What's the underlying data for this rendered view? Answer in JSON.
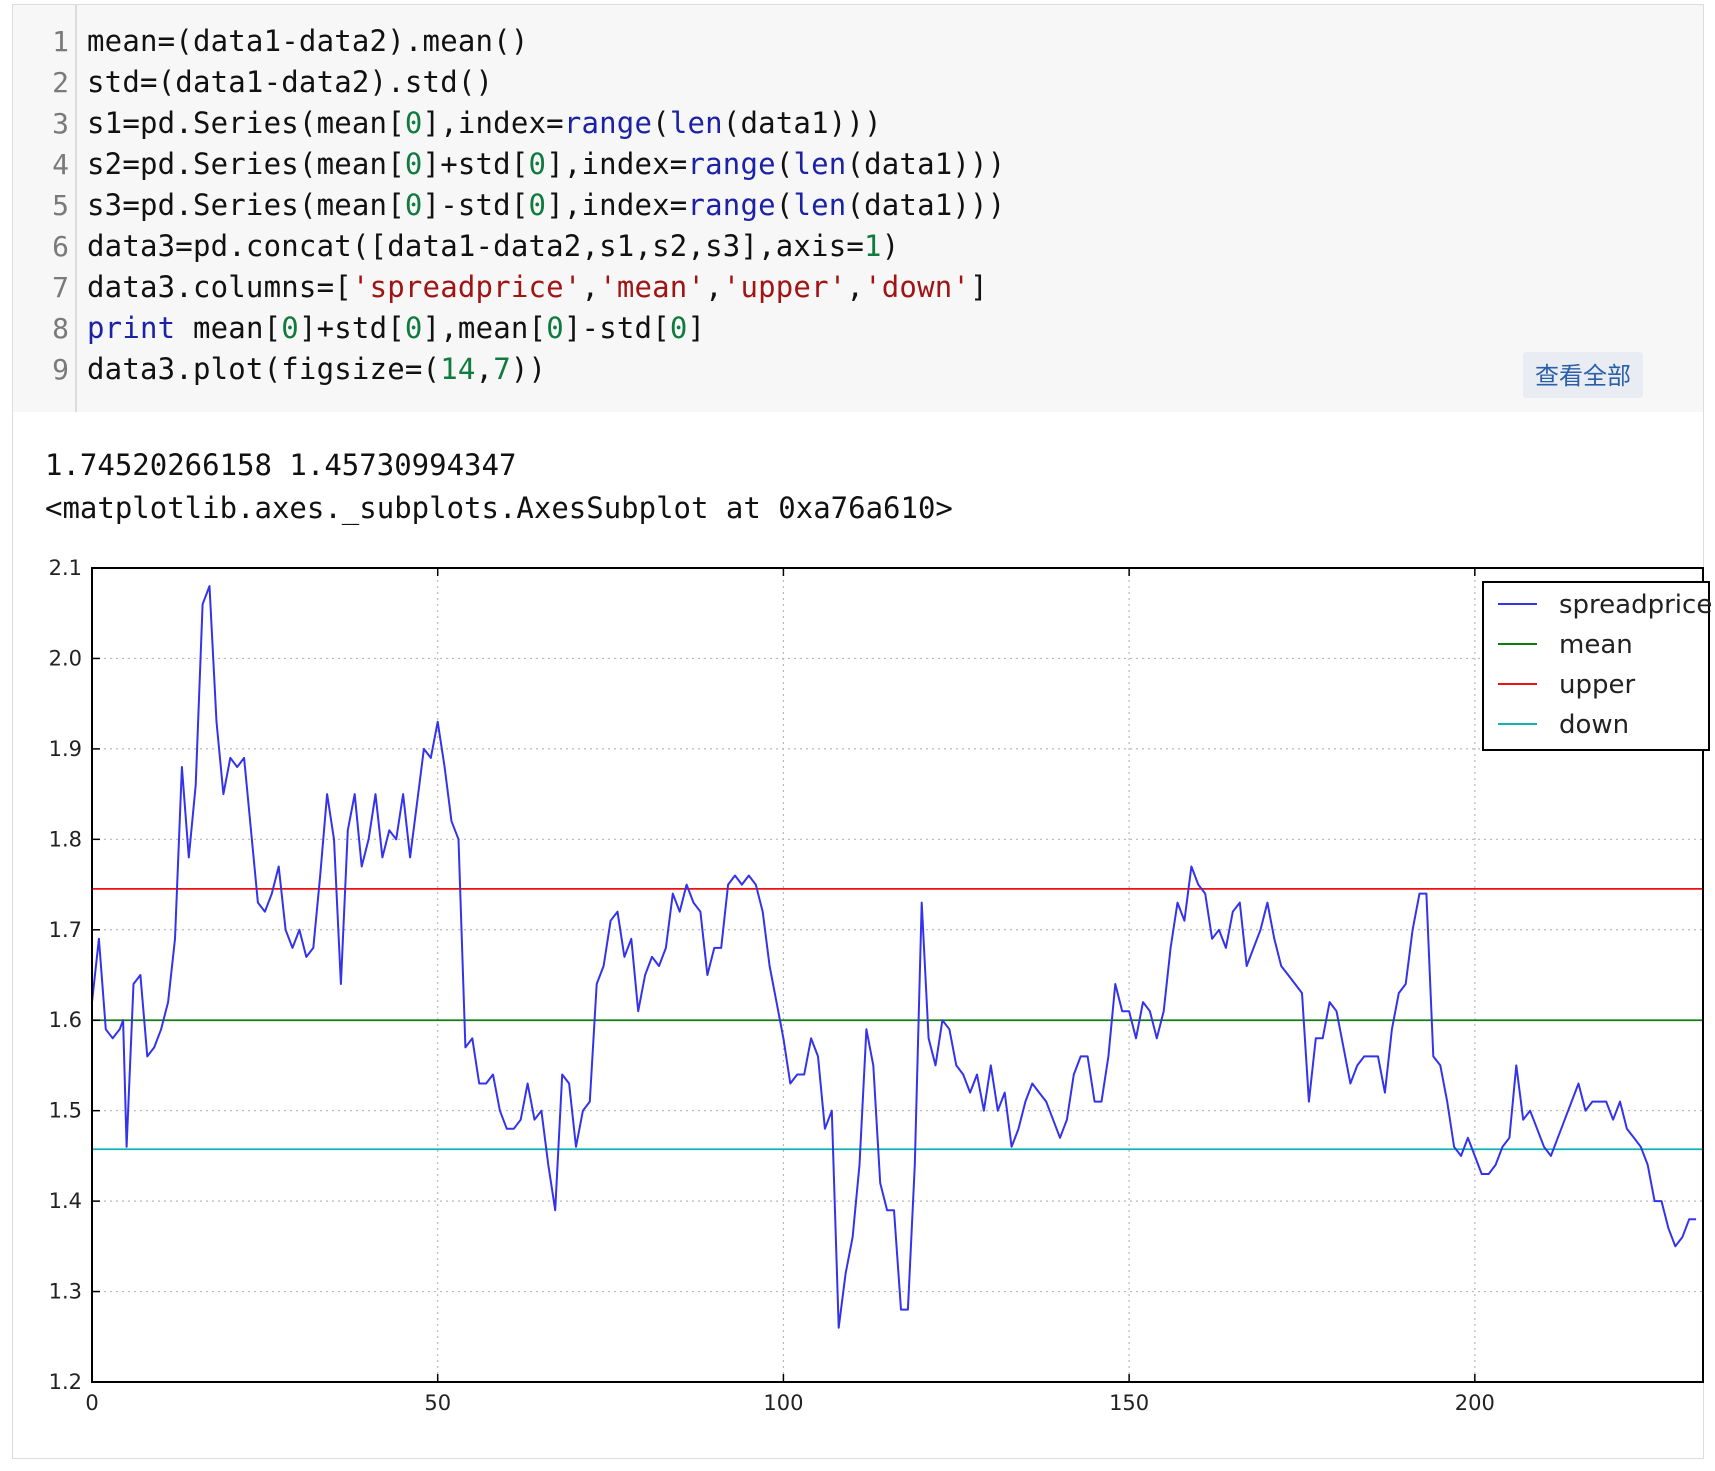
{
  "code_cell": {
    "lines": [
      {
        "num": "1",
        "text": "mean=(data1-data2).mean()"
      },
      {
        "num": "2",
        "text": "std=(data1-data2).std()"
      },
      {
        "num": "3",
        "text": "s1=pd.Series(mean[0],index=range(len(data1)))"
      },
      {
        "num": "4",
        "text": "s2=pd.Series(mean[0]+std[0],index=range(len(data1)))"
      },
      {
        "num": "5",
        "text": "s3=pd.Series(mean[0]-std[0],index=range(len(data1)))"
      },
      {
        "num": "6",
        "text": "data3=pd.concat([data1-data2,s1,s2,s3],axis=1)"
      },
      {
        "num": "7",
        "text": "data3.columns=['spreadprice','mean','upper','down']"
      },
      {
        "num": "8",
        "text": "print mean[0]+std[0],mean[0]-std[0]"
      },
      {
        "num": "9",
        "text": "data3.plot(figsize=(14,7))"
      }
    ],
    "view_all_label": "查看全部"
  },
  "output": {
    "line1": "1.74520266158 1.45730994347",
    "line2": "<matplotlib.axes._subplots.AxesSubplot at 0xa76a610>"
  },
  "chart_data": {
    "type": "line",
    "title": "",
    "xlabel": "",
    "ylabel": "",
    "xlim": [
      0,
      233
    ],
    "ylim": [
      1.2,
      2.1
    ],
    "xticks": [
      "0",
      "50",
      "100",
      "150",
      "200"
    ],
    "yticks": [
      "1.2",
      "1.3",
      "1.4",
      "1.5",
      "1.6",
      "1.7",
      "1.8",
      "1.9",
      "2.0",
      "2.1"
    ],
    "grid": true,
    "legend_position": "top-right",
    "series": [
      {
        "name": "spreadprice",
        "color": "#3333ee",
        "points": [
          [
            0,
            1.62
          ],
          [
            1,
            1.69
          ],
          [
            2,
            1.59
          ],
          [
            3,
            1.58
          ],
          [
            4,
            1.59
          ],
          [
            4.5,
            1.6
          ],
          [
            5,
            1.46
          ],
          [
            6,
            1.64
          ],
          [
            7,
            1.65
          ],
          [
            8,
            1.56
          ],
          [
            9,
            1.57
          ],
          [
            10,
            1.59
          ],
          [
            11,
            1.62
          ],
          [
            12,
            1.69
          ],
          [
            13,
            1.88
          ],
          [
            14,
            1.78
          ],
          [
            15,
            1.86
          ],
          [
            16,
            2.06
          ],
          [
            17,
            2.08
          ],
          [
            18,
            1.93
          ],
          [
            19,
            1.85
          ],
          [
            20,
            1.89
          ],
          [
            21,
            1.88
          ],
          [
            22,
            1.89
          ],
          [
            23,
            1.81
          ],
          [
            24,
            1.73
          ],
          [
            25,
            1.72
          ],
          [
            26,
            1.74
          ],
          [
            27,
            1.77
          ],
          [
            28,
            1.7
          ],
          [
            29,
            1.68
          ],
          [
            30,
            1.7
          ],
          [
            31,
            1.67
          ],
          [
            32,
            1.68
          ],
          [
            33,
            1.76
          ],
          [
            34,
            1.85
          ],
          [
            35,
            1.8
          ],
          [
            36,
            1.64
          ],
          [
            37,
            1.81
          ],
          [
            38,
            1.85
          ],
          [
            39,
            1.77
          ],
          [
            40,
            1.8
          ],
          [
            41,
            1.85
          ],
          [
            42,
            1.78
          ],
          [
            43,
            1.81
          ],
          [
            44,
            1.8
          ],
          [
            45,
            1.85
          ],
          [
            46,
            1.78
          ],
          [
            47,
            1.84
          ],
          [
            48,
            1.9
          ],
          [
            49,
            1.89
          ],
          [
            50,
            1.93
          ],
          [
            51,
            1.88
          ],
          [
            52,
            1.82
          ],
          [
            53,
            1.8
          ],
          [
            54,
            1.57
          ],
          [
            55,
            1.58
          ],
          [
            56,
            1.53
          ],
          [
            57,
            1.53
          ],
          [
            58,
            1.54
          ],
          [
            59,
            1.5
          ],
          [
            60,
            1.48
          ],
          [
            61,
            1.48
          ],
          [
            62,
            1.49
          ],
          [
            63,
            1.53
          ],
          [
            64,
            1.49
          ],
          [
            65,
            1.5
          ],
          [
            66,
            1.44
          ],
          [
            67,
            1.39
          ],
          [
            68,
            1.54
          ],
          [
            69,
            1.53
          ],
          [
            70,
            1.46
          ],
          [
            71,
            1.5
          ],
          [
            72,
            1.51
          ],
          [
            73,
            1.64
          ],
          [
            74,
            1.66
          ],
          [
            75,
            1.71
          ],
          [
            76,
            1.72
          ],
          [
            77,
            1.67
          ],
          [
            78,
            1.69
          ],
          [
            79,
            1.61
          ],
          [
            80,
            1.65
          ],
          [
            81,
            1.67
          ],
          [
            82,
            1.66
          ],
          [
            83,
            1.68
          ],
          [
            84,
            1.74
          ],
          [
            85,
            1.72
          ],
          [
            86,
            1.75
          ],
          [
            87,
            1.73
          ],
          [
            88,
            1.72
          ],
          [
            89,
            1.65
          ],
          [
            90,
            1.68
          ],
          [
            91,
            1.68
          ],
          [
            92,
            1.75
          ],
          [
            93,
            1.76
          ],
          [
            94,
            1.75
          ],
          [
            95,
            1.76
          ],
          [
            96,
            1.75
          ],
          [
            97,
            1.72
          ],
          [
            98,
            1.66
          ],
          [
            99,
            1.62
          ],
          [
            100,
            1.58
          ],
          [
            101,
            1.53
          ],
          [
            102,
            1.54
          ],
          [
            103,
            1.54
          ],
          [
            104,
            1.58
          ],
          [
            105,
            1.56
          ],
          [
            106,
            1.48
          ],
          [
            107,
            1.5
          ],
          [
            108,
            1.26
          ],
          [
            109,
            1.32
          ],
          [
            110,
            1.36
          ],
          [
            111,
            1.44
          ],
          [
            112,
            1.59
          ],
          [
            113,
            1.55
          ],
          [
            114,
            1.42
          ],
          [
            115,
            1.39
          ],
          [
            116,
            1.39
          ],
          [
            117,
            1.28
          ],
          [
            118,
            1.28
          ],
          [
            119,
            1.44
          ],
          [
            120,
            1.73
          ],
          [
            121,
            1.58
          ],
          [
            122,
            1.55
          ],
          [
            123,
            1.6
          ],
          [
            124,
            1.59
          ],
          [
            125,
            1.55
          ],
          [
            126,
            1.54
          ],
          [
            127,
            1.52
          ],
          [
            128,
            1.54
          ],
          [
            129,
            1.5
          ],
          [
            130,
            1.55
          ],
          [
            131,
            1.5
          ],
          [
            132,
            1.52
          ],
          [
            133,
            1.46
          ],
          [
            134,
            1.48
          ],
          [
            135,
            1.51
          ],
          [
            136,
            1.53
          ],
          [
            137,
            1.52
          ],
          [
            138,
            1.51
          ],
          [
            139,
            1.49
          ],
          [
            140,
            1.47
          ],
          [
            141,
            1.49
          ],
          [
            142,
            1.54
          ],
          [
            143,
            1.56
          ],
          [
            144,
            1.56
          ],
          [
            145,
            1.51
          ],
          [
            146,
            1.51
          ],
          [
            147,
            1.56
          ],
          [
            148,
            1.64
          ],
          [
            149,
            1.61
          ],
          [
            150,
            1.61
          ],
          [
            151,
            1.58
          ],
          [
            152,
            1.62
          ],
          [
            153,
            1.61
          ],
          [
            154,
            1.58
          ],
          [
            155,
            1.61
          ],
          [
            156,
            1.68
          ],
          [
            157,
            1.73
          ],
          [
            158,
            1.71
          ],
          [
            159,
            1.77
          ],
          [
            160,
            1.75
          ],
          [
            161,
            1.74
          ],
          [
            162,
            1.69
          ],
          [
            163,
            1.7
          ],
          [
            164,
            1.68
          ],
          [
            165,
            1.72
          ],
          [
            166,
            1.73
          ],
          [
            167,
            1.66
          ],
          [
            168,
            1.68
          ],
          [
            169,
            1.7
          ],
          [
            170,
            1.73
          ],
          [
            171,
            1.69
          ],
          [
            172,
            1.66
          ],
          [
            173,
            1.65
          ],
          [
            174,
            1.64
          ],
          [
            175,
            1.63
          ],
          [
            176,
            1.51
          ],
          [
            177,
            1.58
          ],
          [
            178,
            1.58
          ],
          [
            179,
            1.62
          ],
          [
            180,
            1.61
          ],
          [
            181,
            1.57
          ],
          [
            182,
            1.53
          ],
          [
            183,
            1.55
          ],
          [
            184,
            1.56
          ],
          [
            185,
            1.56
          ],
          [
            186,
            1.56
          ],
          [
            187,
            1.52
          ],
          [
            188,
            1.59
          ],
          [
            189,
            1.63
          ],
          [
            190,
            1.64
          ],
          [
            191,
            1.7
          ],
          [
            192,
            1.74
          ],
          [
            193,
            1.74
          ],
          [
            194,
            1.56
          ],
          [
            195,
            1.55
          ],
          [
            196,
            1.51
          ],
          [
            197,
            1.46
          ],
          [
            198,
            1.45
          ],
          [
            199,
            1.47
          ],
          [
            200,
            1.45
          ],
          [
            201,
            1.43
          ],
          [
            202,
            1.43
          ],
          [
            203,
            1.44
          ],
          [
            204,
            1.46
          ],
          [
            205,
            1.47
          ],
          [
            206,
            1.55
          ],
          [
            207,
            1.49
          ],
          [
            208,
            1.5
          ],
          [
            209,
            1.48
          ],
          [
            210,
            1.46
          ],
          [
            211,
            1.45
          ],
          [
            212,
            1.47
          ],
          [
            213,
            1.49
          ],
          [
            214,
            1.51
          ],
          [
            215,
            1.53
          ],
          [
            216,
            1.5
          ],
          [
            217,
            1.51
          ],
          [
            218,
            1.51
          ],
          [
            219,
            1.51
          ],
          [
            220,
            1.49
          ],
          [
            221,
            1.51
          ],
          [
            222,
            1.48
          ],
          [
            223,
            1.47
          ],
          [
            224,
            1.46
          ],
          [
            225,
            1.44
          ],
          [
            226,
            1.4
          ],
          [
            227,
            1.4
          ],
          [
            228,
            1.37
          ],
          [
            229,
            1.35
          ],
          [
            230,
            1.36
          ],
          [
            231,
            1.38
          ],
          [
            232,
            1.38
          ]
        ]
      },
      {
        "name": "mean",
        "color": "#117a11",
        "value": 1.6
      },
      {
        "name": "upper",
        "color": "#ee1111",
        "value": 1.74520266158
      },
      {
        "name": "down",
        "color": "#11b2b2",
        "value": 1.45730994347
      }
    ]
  }
}
